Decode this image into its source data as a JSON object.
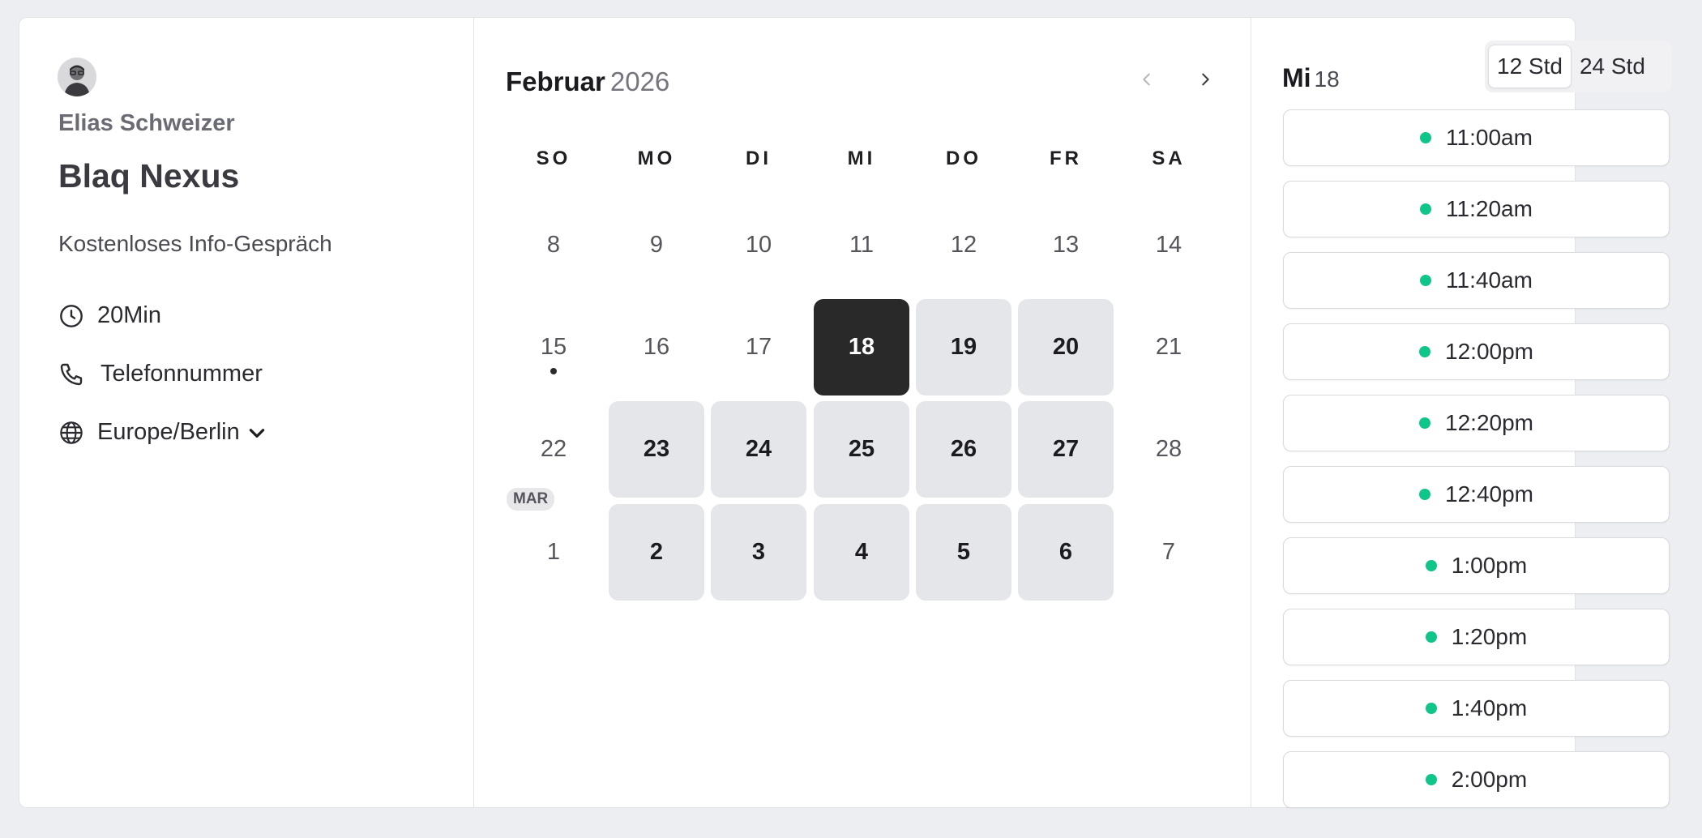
{
  "profile": {
    "host_name": "Elias Schweizer",
    "event_title": "Blaq Nexus",
    "event_description": "Kostenloses Info-Gespräch",
    "duration": "20Min",
    "location": "Telefonnummer",
    "timezone": "Europe/Berlin"
  },
  "calendar": {
    "month": "Februar",
    "year": "2026",
    "weekdays": [
      "SO",
      "MO",
      "DI",
      "MI",
      "DO",
      "FR",
      "SA"
    ],
    "next_month_badge": "MAR",
    "weeks": [
      [
        {
          "d": "8"
        },
        {
          "d": "9"
        },
        {
          "d": "10"
        },
        {
          "d": "11"
        },
        {
          "d": "12"
        },
        {
          "d": "13"
        },
        {
          "d": "14"
        }
      ],
      [
        {
          "d": "15",
          "today": true
        },
        {
          "d": "16"
        },
        {
          "d": "17"
        },
        {
          "d": "18",
          "selected": true
        },
        {
          "d": "19",
          "available": true
        },
        {
          "d": "20",
          "available": true
        },
        {
          "d": "21"
        }
      ],
      [
        {
          "d": "22"
        },
        {
          "d": "23",
          "available": true
        },
        {
          "d": "24",
          "available": true
        },
        {
          "d": "25",
          "available": true
        },
        {
          "d": "26",
          "available": true
        },
        {
          "d": "27",
          "available": true
        },
        {
          "d": "28"
        }
      ],
      [
        {
          "d": "1"
        },
        {
          "d": "2",
          "available": true
        },
        {
          "d": "3",
          "available": true
        },
        {
          "d": "4",
          "available": true
        },
        {
          "d": "5",
          "available": true
        },
        {
          "d": "6",
          "available": true
        },
        {
          "d": "7"
        }
      ]
    ]
  },
  "times": {
    "day_label": "Mi",
    "day_number": "18",
    "format_options": [
      "12 Std",
      "24 Std"
    ],
    "selected_format": "12 Std",
    "slots": [
      "11:00am",
      "11:20am",
      "11:40am",
      "12:00pm",
      "12:20pm",
      "12:40pm",
      "1:00pm",
      "1:20pm",
      "1:40pm",
      "2:00pm"
    ]
  },
  "colors": {
    "selected_day": "#292929",
    "available_day": "#e5e6ea",
    "slot_dot": "#0fc58a"
  }
}
